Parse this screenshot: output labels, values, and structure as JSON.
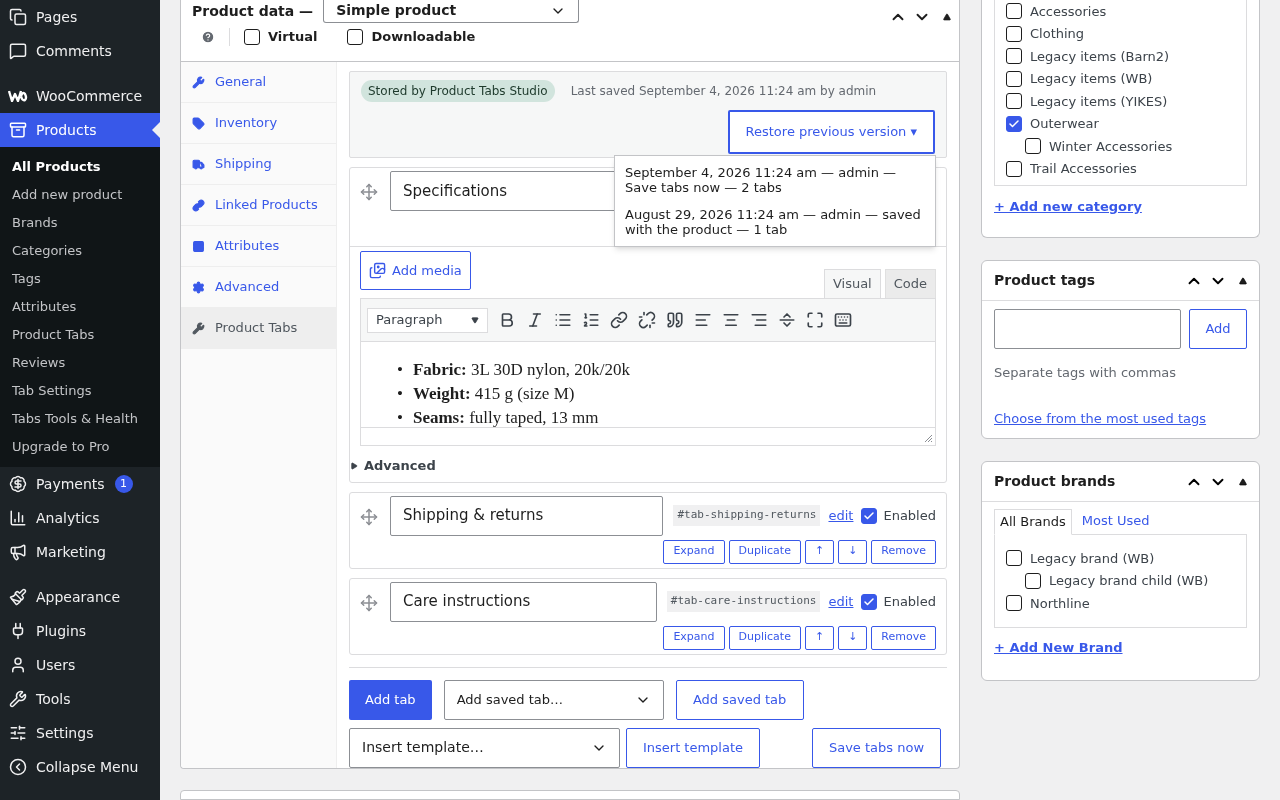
{
  "sidebar": {
    "groups": [
      [
        {
          "label": "Pages",
          "selected": false
        },
        {
          "label": "Comments",
          "selected": false
        }
      ],
      [
        {
          "label": "WooCommerce",
          "selected": false
        },
        {
          "label": "Products",
          "selected": true,
          "children": [
            {
              "label": "All Products",
              "selected": true
            },
            {
              "label": "Add new product",
              "selected": false
            },
            {
              "label": "Brands",
              "selected": false
            },
            {
              "label": "Categories",
              "selected": false
            },
            {
              "label": "Tags",
              "selected": false
            },
            {
              "label": "Attributes",
              "selected": false
            },
            {
              "label": "Product Tabs",
              "selected": false
            },
            {
              "label": "Reviews",
              "selected": false
            },
            {
              "label": "Tab Settings",
              "selected": false
            },
            {
              "label": "Tabs Tools & Health",
              "selected": false
            },
            {
              "label": "Upgrade to Pro",
              "selected": false
            }
          ]
        },
        {
          "label": "Payments",
          "selected": false,
          "badge": "1"
        },
        {
          "label": "Analytics",
          "selected": false
        },
        {
          "label": "Marketing",
          "selected": false
        }
      ],
      [
        {
          "label": "Appearance",
          "selected": false
        },
        {
          "label": "Plugins",
          "selected": false
        },
        {
          "label": "Users",
          "selected": false
        },
        {
          "label": "Tools",
          "selected": false
        },
        {
          "label": "Settings",
          "selected": false
        },
        {
          "label": "Collapse Menu",
          "selected": false
        }
      ]
    ]
  },
  "product_data": {
    "title": "Product data —",
    "type_select": "Simple product",
    "options": [
      {
        "label": "Virtual",
        "checked": false
      },
      {
        "label": "Downloadable",
        "checked": false
      }
    ],
    "tabs": [
      {
        "label": "General",
        "selected": false
      },
      {
        "label": "Inventory",
        "selected": false
      },
      {
        "label": "Shipping",
        "selected": false
      },
      {
        "label": "Linked Products",
        "selected": false
      },
      {
        "label": "Attributes",
        "selected": false
      },
      {
        "label": "Advanced",
        "selected": false
      },
      {
        "label": "Product Tabs",
        "selected": true
      }
    ],
    "storage": {
      "badge": "Stored by Product Tabs Studio",
      "last_saved": "Last saved September 4, 2026 11:24 am by admin",
      "restore_button": "Restore previous version ▾",
      "expanded": true,
      "versions": [
        "September 4, 2026 11:24 am — admin — Save tabs now — 2 tabs",
        "August 29, 2026 11:24 am — admin — saved with the product — 1 tab"
      ]
    },
    "product_tabs": [
      {
        "title": "Specifications",
        "expanded": true,
        "editor": {
          "add_media": "Add media",
          "modes": [
            {
              "label": "Visual",
              "selected": true
            },
            {
              "label": "Code",
              "selected": false
            }
          ],
          "format_select": "Paragraph",
          "bullet": "•",
          "content": [
            "**Fabric:** 3L 30D nylon, 20k/20k",
            "**Weight:** 415 g (size M)",
            "**Seams:** fully taped, 13 mm"
          ],
          "advanced": "Advanced"
        }
      },
      {
        "title": "Shipping & returns",
        "expanded": false,
        "slug": "#tab-shipping-returns",
        "edit": "edit",
        "enabled": true,
        "enabled_label": "Enabled",
        "buttons": [
          "Expand",
          "Duplicate",
          "↑",
          "↓",
          "Remove"
        ]
      },
      {
        "title": "Care instructions",
        "expanded": false,
        "slug": "#tab-care-instructions",
        "edit": "edit",
        "enabled": true,
        "enabled_label": "Enabled",
        "buttons": [
          "Expand",
          "Duplicate",
          "↑",
          "↓",
          "Remove"
        ]
      }
    ],
    "actions": {
      "add_tab": "Add tab",
      "saved_tab_select": "Add saved tab…",
      "add_saved_tab": "Add saved tab",
      "template_select": "Insert template…",
      "insert_template": "Insert template",
      "save_now": "Save tabs now"
    }
  },
  "categories": {
    "items": [
      {
        "label": "Accessories",
        "checked": false
      },
      {
        "label": "Clothing",
        "checked": false
      },
      {
        "label": "Legacy items (Barn2)",
        "checked": false
      },
      {
        "label": "Legacy items (WB)",
        "checked": false
      },
      {
        "label": "Legacy items (YIKES)",
        "checked": false
      },
      {
        "label": "Outerwear",
        "checked": true,
        "children": [
          {
            "label": "Winter Accessories",
            "checked": false
          }
        ]
      },
      {
        "label": "Trail Accessories",
        "checked": false
      }
    ],
    "add_link": "+ Add new category"
  },
  "tags": {
    "title": "Product tags",
    "add_button": "Add",
    "hint": "Separate tags with commas",
    "link": "Choose from the most used tags"
  },
  "brands": {
    "title": "Product brands",
    "tabs": [
      {
        "label": "All Brands",
        "selected": true
      },
      {
        "label": "Most Used",
        "selected": false
      }
    ],
    "items": [
      {
        "label": "Legacy brand (WB)",
        "checked": false,
        "children": [
          {
            "label": "Legacy brand child (WB)",
            "checked": false
          }
        ]
      },
      {
        "label": "Northline",
        "checked": false
      }
    ],
    "add_link": "+ Add New Brand"
  }
}
